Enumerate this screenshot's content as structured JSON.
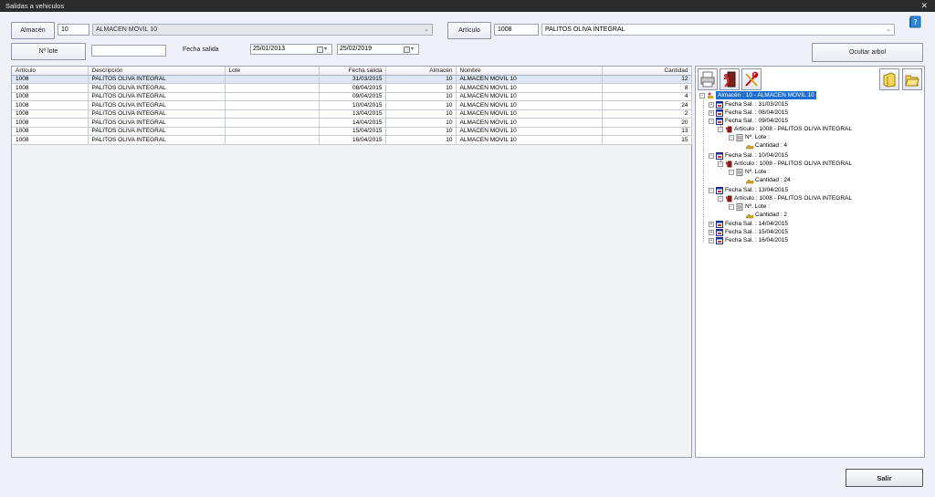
{
  "window": {
    "title": "Salidas a vehiculos",
    "close": "✕"
  },
  "filters": {
    "almacen_button": "Almacén",
    "almacen_code": "10",
    "almacen_name": "ALMACEN MOVIL 10",
    "articulo_button": "Artículo",
    "articulo_code": "1008",
    "articulo_name": "PALITOS OLIVA INTEGRAL",
    "lote_button": "Nº lote",
    "lote_value": "",
    "fecha_salida_label": "Fecha salida",
    "fecha_desde": "25/01/2013",
    "fecha_hasta": "25/02/2019",
    "ocultar_arbol": "Ocultar arbol"
  },
  "grid": {
    "columns": [
      "Artículo",
      "Descripción",
      "Lote",
      "Fecha salida",
      "Almacén",
      "Nombre",
      "Cantidad"
    ],
    "rows": [
      [
        "1008",
        "PALITOS OLIVA INTEGRAL",
        "",
        "31/03/2015",
        "10",
        "ALMACEN MOVIL 10",
        "12"
      ],
      [
        "1008",
        "PALITOS OLIVA INTEGRAL",
        "",
        "08/04/2015",
        "10",
        "ALMACEN MOVIL 10",
        "8"
      ],
      [
        "1008",
        "PALITOS OLIVA INTEGRAL",
        "",
        "09/04/2015",
        "10",
        "ALMACEN MOVIL 10",
        "4"
      ],
      [
        "1008",
        "PALITOS OLIVA INTEGRAL",
        "",
        "10/04/2015",
        "10",
        "ALMACEN MOVIL 10",
        "24"
      ],
      [
        "1008",
        "PALITOS OLIVA INTEGRAL",
        "",
        "13/04/2015",
        "10",
        "ALMACEN MOVIL 10",
        "2"
      ],
      [
        "1008",
        "PALITOS OLIVA INTEGRAL",
        "",
        "14/04/2015",
        "10",
        "ALMACEN MOVIL 10",
        "20"
      ],
      [
        "1008",
        "PALITOS OLIVA INTEGRAL",
        "",
        "15/04/2015",
        "10",
        "ALMACEN MOVIL 10",
        "13"
      ],
      [
        "1008",
        "PALITOS OLIVA INTEGRAL",
        "",
        "16/04/2015",
        "10",
        "ALMACEN MOVIL 10",
        "15"
      ]
    ]
  },
  "tree": {
    "root": "Almacén : 10 - ALMACEN MOVIL 10",
    "f1": "Fecha Sal. : 31/03/2015",
    "f2": "Fecha Sal. : 08/04/2015",
    "f3": "Fecha Sal. : 09/04/2015",
    "a3": "Artículo : 1008 - PALITOS OLIVA INTEGRAL",
    "l3": "Nº. Lote :",
    "c3": "Cantidad : 4",
    "f4": "Fecha Sal. : 10/04/2015",
    "a4": "Artículo : 1008 - PALITOS OLIVA INTEGRAL",
    "l4": "Nº. Lote :",
    "c4": "Cantidad : 24",
    "f5": "Fecha Sal. : 13/04/2015",
    "a5": "Artículo : 1008 - PALITOS OLIVA INTEGRAL",
    "l5": "Nº. Lote :",
    "c5": "Cantidad : 2",
    "f6": "Fecha Sal. : 14/04/2015",
    "f7": "Fecha Sal. : 15/04/2015",
    "f8": "Fecha Sal. : 16/04/2015"
  },
  "footer": {
    "salir": "Salir"
  },
  "colors": {
    "selection": "#1c6fd1",
    "titlebar": "#2b2b2b"
  },
  "icons": [
    "help-book-icon",
    "printer-icon",
    "exit-door-icon",
    "tools-icon",
    "expand-folder-icon",
    "open-folder-icon",
    "warehouse-icon",
    "date-icon",
    "article-icon",
    "lot-icon",
    "quantity-icon"
  ]
}
